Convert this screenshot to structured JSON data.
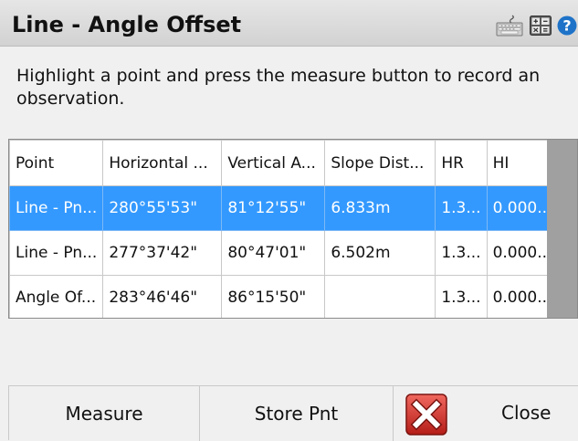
{
  "window": {
    "title": "Line - Angle Offset",
    "icons": [
      "keyboard-icon",
      "calculator-icon",
      "help-icon"
    ]
  },
  "instruction": "Highlight a point and press the measure button to record an observation.",
  "table": {
    "columns": [
      "Point",
      "Horizontal ...",
      "Vertical A...",
      "Slope Dist...",
      "HR",
      "HI"
    ],
    "rows": [
      [
        "Line - Pn...",
        "280°55'53\"",
        "81°12'55\"",
        "6.833m",
        "1.3...",
        "0.000..."
      ],
      [
        "Line - Pn...",
        "277°37'42\"",
        "80°47'01\"",
        "6.502m",
        "1.3...",
        "0.000..."
      ],
      [
        "Angle Of...",
        "283°46'46\"",
        "86°15'50\"",
        "",
        "1.3...",
        "0.000..."
      ]
    ],
    "selected_row_index": 0
  },
  "buttons": {
    "measure": "Measure",
    "store": "Store Pnt",
    "close": "Close"
  },
  "colors": {
    "selection": "#3399ff",
    "close_icon_red": "#d8312c"
  }
}
